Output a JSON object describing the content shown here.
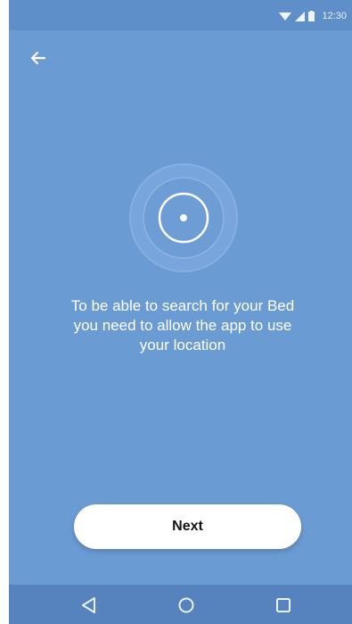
{
  "status_bar": {
    "time": "12:30",
    "icons": [
      "wifi-icon",
      "cellular-signal-icon",
      "battery-icon"
    ]
  },
  "header": {
    "back_icon": "arrow-left-icon"
  },
  "main": {
    "illustration_icon": "location-radar-icon",
    "message_lines": [
      "To be able to search for your Bed",
      "you need to allow the app to use",
      "your location"
    ],
    "next_label": "Next"
  },
  "nav_bar": {
    "icons": [
      "nav-back-icon",
      "nav-home-icon",
      "nav-recents-icon"
    ]
  },
  "colors": {
    "background": "#6b9bd3",
    "status_bar": "#5f8fc8",
    "nav_bar": "#5683bd",
    "button": "#ffffff"
  }
}
